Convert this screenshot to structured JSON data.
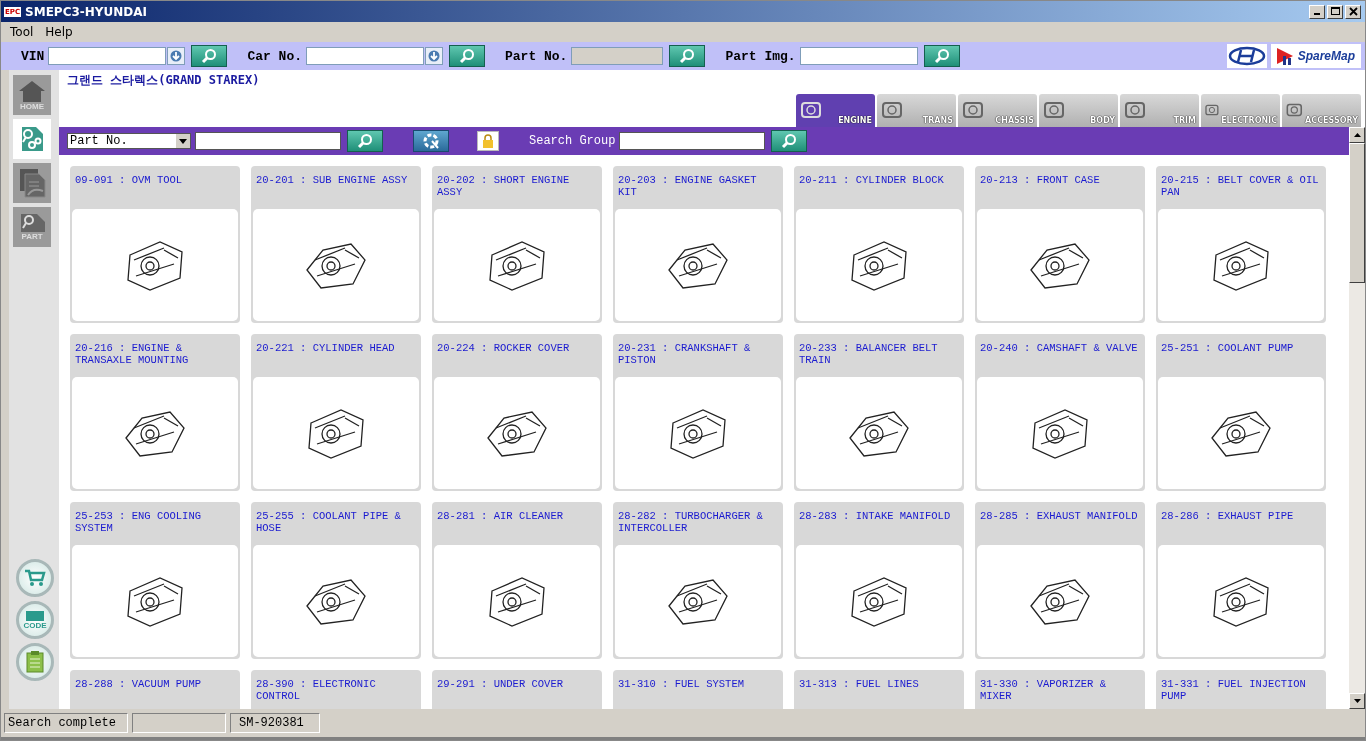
{
  "window": {
    "title": "SMEPC3-HYUNDAI",
    "app_badge": "EPC"
  },
  "menu": [
    "Tool",
    "Help"
  ],
  "toolbar": {
    "fields": [
      {
        "label": "VIN",
        "kind": "dropdown"
      },
      {
        "label": "Car No.",
        "kind": "dropdown"
      },
      {
        "label": "Part No.",
        "kind": "disabled"
      },
      {
        "label": "Part Img.",
        "kind": "plain"
      }
    ],
    "brand": "SpareMap"
  },
  "sidebar": {
    "top": [
      {
        "kind": "home",
        "label": "HOME",
        "selected": false
      },
      {
        "kind": "search",
        "selected": true
      },
      {
        "kind": "documents",
        "selected": false
      },
      {
        "kind": "part",
        "label": "PART",
        "selected": false
      }
    ],
    "bottom": [
      {
        "kind": "cart"
      },
      {
        "kind": "code",
        "label": "CODE"
      },
      {
        "kind": "notes"
      }
    ]
  },
  "vehicle_title": "그랜드 스타렉스(GRAND STAREX)",
  "category_tabs": [
    {
      "label": "ENGINE",
      "selected": true
    },
    {
      "label": "TRANS",
      "selected": false
    },
    {
      "label": "CHASSIS",
      "selected": false
    },
    {
      "label": "BODY",
      "selected": false
    },
    {
      "label": "TRIM",
      "selected": false
    },
    {
      "label": "ELECTRONIC",
      "selected": false
    },
    {
      "label": "ACCESSORY",
      "selected": false
    }
  ],
  "search_bar": {
    "select_value": "Part No.",
    "search_group_label": "Search Group"
  },
  "groups": [
    {
      "title": "09-091 : OVM TOOL"
    },
    {
      "title": "20-201 : SUB ENGINE ASSY"
    },
    {
      "title": "20-202 : SHORT ENGINE ASSY"
    },
    {
      "title": "20-203 : ENGINE GASKET KIT"
    },
    {
      "title": "20-211 : CYLINDER BLOCK"
    },
    {
      "title": "20-213 : FRONT CASE"
    },
    {
      "title": "20-215 : BELT COVER & OIL PAN"
    },
    {
      "title": "20-216 : ENGINE & TRANSAXLE MOUNTING"
    },
    {
      "title": "20-221 : CYLINDER HEAD"
    },
    {
      "title": "20-224 : ROCKER COVER"
    },
    {
      "title": "20-231 : CRANKSHAFT & PISTON"
    },
    {
      "title": "20-233 : BALANCER BELT TRAIN"
    },
    {
      "title": "20-240 : CAMSHAFT & VALVE"
    },
    {
      "title": "25-251 : COOLANT PUMP"
    },
    {
      "title": "25-253 : ENG COOLING SYSTEM"
    },
    {
      "title": "25-255 : COOLANT PIPE & HOSE"
    },
    {
      "title": "28-281 : AIR CLEANER"
    },
    {
      "title": "28-282 : TURBOCHARGER & INTERCOLLER"
    },
    {
      "title": "28-283 : INTAKE MANIFOLD"
    },
    {
      "title": "28-285 : EXHAUST MANIFOLD"
    },
    {
      "title": "28-286 : EXHAUST PIPE"
    },
    {
      "title": "28-288 : VACUUM PUMP"
    },
    {
      "title": "28-390 : ELECTRONIC CONTROL"
    },
    {
      "title": "29-291 : UNDER COVER"
    },
    {
      "title": "31-310 : FUEL SYSTEM"
    },
    {
      "title": "31-313 : FUEL LINES"
    },
    {
      "title": "31-330 : VAPORIZER & MIXER"
    },
    {
      "title": "31-331 : FUEL INJECTION PUMP"
    }
  ],
  "status_bar": {
    "message": "Search complete",
    "code": "SM-920381"
  }
}
